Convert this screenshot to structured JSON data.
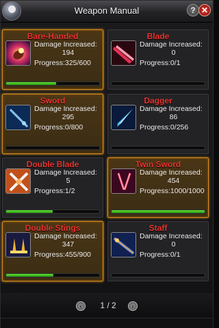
{
  "window": {
    "title": "Weapon Manual",
    "help_label": "?",
    "close_label": "✕"
  },
  "cards": [
    {
      "name": "Bare-Handed",
      "damage_label": "Damage Increased:",
      "damage": "194",
      "progress_text": "Progress:325/600",
      "progress": 0.54,
      "unlocked": true,
      "icon": "fist-icon"
    },
    {
      "name": "Blade",
      "damage_label": "Damage Increased:",
      "damage": "0",
      "progress_text": "Progress:0/1",
      "progress": 0,
      "unlocked": false,
      "icon": "blade-icon"
    },
    {
      "name": "Sword",
      "damage_label": "Damage Increased:",
      "damage": "295",
      "progress_text": "Progress:0/800",
      "progress": 0,
      "unlocked": true,
      "icon": "sword-icon"
    },
    {
      "name": "Dagger",
      "damage_label": "Damage Increased:",
      "damage": "86",
      "progress_text": "Progress:0/256",
      "progress": 0,
      "unlocked": false,
      "icon": "dagger-icon"
    },
    {
      "name": "Double Blade",
      "damage_label": "Damage Increased:",
      "damage": "5",
      "progress_text": "Progress:1/2",
      "progress": 0.5,
      "unlocked": false,
      "icon": "double-blade-icon"
    },
    {
      "name": "Twin Sword",
      "damage_label": "Damage Increased:",
      "damage": "454",
      "progress_text": "Progress:1000/1000",
      "progress": 1.0,
      "unlocked": true,
      "icon": "twin-sword-icon"
    },
    {
      "name": "Double Stings",
      "damage_label": "Damage Increased:",
      "damage": "347",
      "progress_text": "Progress:455/900",
      "progress": 0.51,
      "unlocked": true,
      "icon": "double-stings-icon"
    },
    {
      "name": "Staff",
      "damage_label": "Damage Increased:",
      "damage": "0",
      "progress_text": "Progress:0/1",
      "progress": 0,
      "unlocked": false,
      "icon": "staff-icon"
    }
  ],
  "pagination": {
    "text": "1 / 2",
    "prev_label": "‹",
    "next_label": "›"
  },
  "colors": {
    "name_red": "#e8332e",
    "progress_green": "#4fd02a",
    "unlocked_border": "#d08a1c"
  }
}
